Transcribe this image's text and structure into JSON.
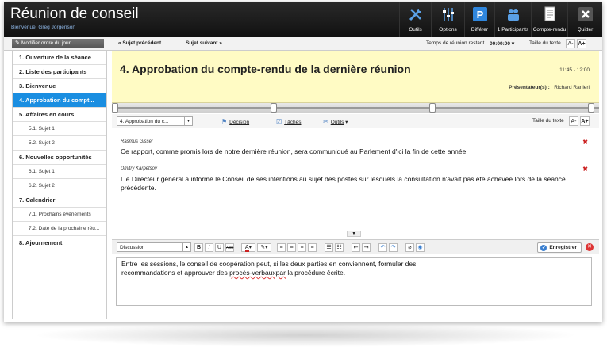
{
  "app": {
    "title": "Réunion de conseil",
    "welcome": "Bienvenue, Greg Jorgenson"
  },
  "header_buttons": [
    {
      "label": "Outils",
      "icon": "tools-icon"
    },
    {
      "label": "Options",
      "icon": "sliders-icon"
    },
    {
      "label": "Différer",
      "icon": "parking-icon"
    },
    {
      "label": "1 Participants",
      "icon": "participants-icon"
    },
    {
      "label": "Compte-rendu",
      "icon": "document-icon"
    },
    {
      "label": "Quitter",
      "icon": "close-icon"
    }
  ],
  "toolbar": {
    "modify_order": "Modifier ordre du jour",
    "prev_subject": "Sujet précédent",
    "next_subject": "Sujet suivant",
    "remaining_label": "Temps de réunion restant",
    "remaining_value": "00:00:00",
    "text_size": "Taille du texte",
    "size_smaller": "A-",
    "size_larger": "A+"
  },
  "sidebar": {
    "items": [
      {
        "label": "1. Ouverture de la séance",
        "level": 1
      },
      {
        "label": "2. Liste des participants",
        "level": 1
      },
      {
        "label": "3. Bienvenue",
        "level": 1
      },
      {
        "label": "4. Approbation du compt...",
        "level": 1,
        "active": true
      },
      {
        "label": "5. Affaires en cours",
        "level": 1
      },
      {
        "label": "5.1. Sujet 1",
        "level": 2
      },
      {
        "label": "5.2. Sujet 2",
        "level": 2
      },
      {
        "label": "6. Nouvelles opportunités",
        "level": 1
      },
      {
        "label": "6.1. Sujet 1",
        "level": 2
      },
      {
        "label": "6.2. Sujet 2",
        "level": 2
      },
      {
        "label": "7. Calendrier",
        "level": 1
      },
      {
        "label": "7.1. Prochains évènements",
        "level": 2
      },
      {
        "label": "7.2. Date de la prochaine réu...",
        "level": 2
      },
      {
        "label": "8. Ajournement",
        "level": 1
      }
    ]
  },
  "agenda": {
    "title": "4. Approbation du compte-rendu de la dernière réunion",
    "time": "11:45 - 12:00",
    "presenter_label": "Présentateur(s) :",
    "presenter_name": "Richard Ranieri"
  },
  "content_toolbar": {
    "item_select": "4. Approbation du c...",
    "decision": "Décision",
    "tasks": "Tâches",
    "tools": "Outils",
    "text_size": "Taille du texte",
    "size_smaller": "A-",
    "size_larger": "A+"
  },
  "comments": [
    {
      "author": "Rasmus Gissel",
      "text": "Ce rapport, comme promis lors de notre dernière réunion, sera communiqué au Parlement d'ici la fin de cette année."
    },
    {
      "author": "Dmitry Karpetsov",
      "text": "L e Directeur général a informé le Conseil de ses intentions au sujet des postes sur lesquels la consultation n'avait pas été achevée lors de la séance précédente."
    }
  ],
  "editor_toolbar": {
    "type_select": "Discussion",
    "bold": "B",
    "italic": "I",
    "underline": "U",
    "strike": "ABC",
    "font_color": "A",
    "save": "Enregistrer"
  },
  "editor": {
    "line1": "Entre les sessions, le conseil de coopération peut, si les deux parties en conviennent, formuler des",
    "line2_a": "recommandations et approuver des ",
    "line2_b": "procès-verbauxpar",
    "line2_c": " la procédure écrite."
  },
  "colors": {
    "accent": "#1a8ee1",
    "title_panel": "#fffbc4",
    "header": "#111111",
    "delete": "#cc2222"
  }
}
